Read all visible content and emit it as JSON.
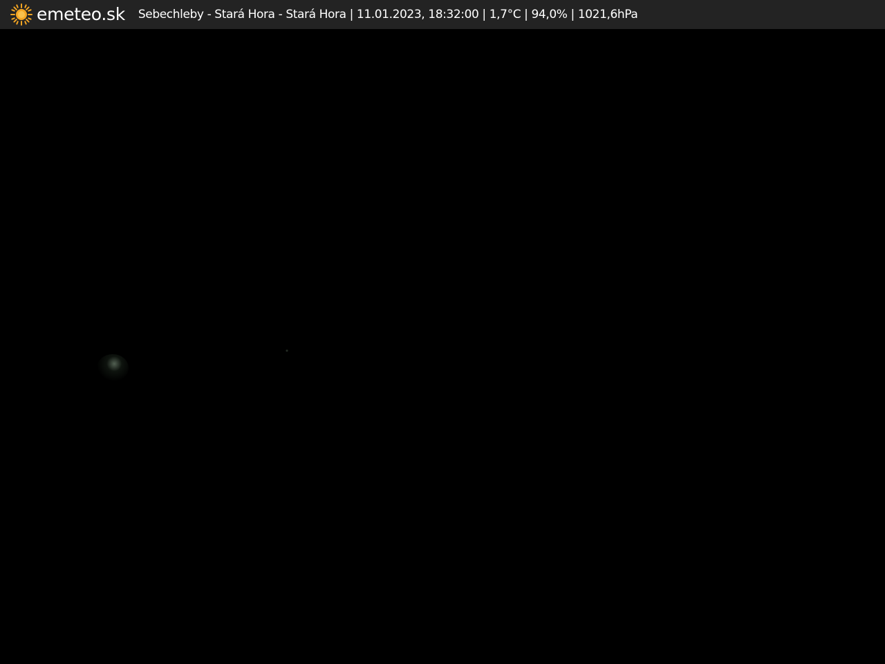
{
  "header": {
    "logo_text": "emeteo.sk",
    "logo_icon": "sun-icon",
    "info_text": "Sebechleby - Stará Hora - Stará Hora | 11.01.2023, 18:32:00 | 1,7°C | 94,0% | 1021,6hPa"
  },
  "colors": {
    "header_background": "#232323",
    "header_text": "#ffffff",
    "sun_icon": "#f5a623",
    "camera_background": "#000000"
  }
}
